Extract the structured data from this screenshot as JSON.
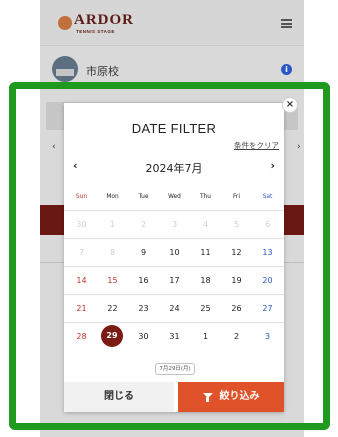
{
  "app": {
    "logo_text": "ARDOR",
    "logo_sub": "TENNIS STAGE",
    "school_name": "市原校",
    "info_icon": "i"
  },
  "modal": {
    "title": "DATE FILTER",
    "clear_label": "条件をクリア",
    "month_label": "2024年7月",
    "prev_icon": "‹",
    "next_icon": "›",
    "close_icon": "×",
    "side_prev_icon": "‹",
    "side_next_icon": "›",
    "weekdays": [
      "Sun",
      "Mon",
      "Tue",
      "Wed",
      "Thu",
      "Fri",
      "Sat"
    ],
    "weeks": [
      [
        "30",
        "1",
        "2",
        "3",
        "4",
        "5",
        "6"
      ],
      [
        "7",
        "8",
        "9",
        "10",
        "11",
        "12",
        "13"
      ],
      [
        "14",
        "15",
        "16",
        "17",
        "18",
        "19",
        "20"
      ],
      [
        "21",
        "22",
        "23",
        "24",
        "25",
        "26",
        "27"
      ],
      [
        "28",
        "29",
        "30",
        "31",
        "1",
        "2",
        "3"
      ]
    ],
    "selected_label": "7月29日(月)",
    "close_button": "閉じる",
    "filter_button": "絞り込み",
    "colors": {
      "sunday": "#c0312b",
      "saturday": "#2a57c4",
      "muted": "#cfcfcf",
      "text": "#222222",
      "selected": "#7c1b16",
      "filter_bg": "#e0522a",
      "frame": "#1f9a1f"
    }
  }
}
